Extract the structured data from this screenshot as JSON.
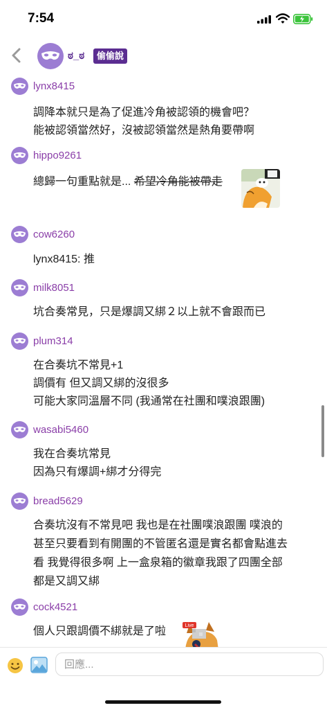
{
  "status_bar": {
    "time": "7:54"
  },
  "header": {
    "author": "ಠ_ಠ",
    "badge": "偷偷說"
  },
  "comments": [
    {
      "user": "lynx8415",
      "lines": [
        "調降本就只是為了促進冷角被認領的機會吧？",
        "能被認領當然好，沒被認領當然是熱角要帶啊"
      ]
    },
    {
      "user": "hippo9261",
      "lines": [
        "總歸一句重點就是... "
      ],
      "strike": "希望冷角能被帶走"
    },
    {
      "user": "cow6260",
      "lines": [
        "lynx8415: 推"
      ]
    },
    {
      "user": "milk8051",
      "lines": [
        "坑合奏常見，只是爆調又綁２以上就不會跟而已"
      ]
    },
    {
      "user": "plum314",
      "lines": [
        "在合奏坑不常見+1",
        "調價有 但又調又綁的沒很多",
        "可能大家同溫層不同 (我通常在社團和噗浪跟團)"
      ]
    },
    {
      "user": "wasabi5460",
      "lines": [
        "我在合奏坑常見",
        "因為只有爆調+綁才分得完"
      ]
    },
    {
      "user": "bread5629",
      "lines": [
        "合奏坑沒有不常見吧 我也是在社團噗浪跟團 噗浪的",
        "甚至只要看到有開團的不管匿名還是實名都會點進去",
        "看 我覺得很多啊 上一盒泉箱的徽章我跟了四團全部",
        "都是又調又綁"
      ]
    },
    {
      "user": "cock4521",
      "lines": [
        "個人只跟調價不綁就是了啦"
      ]
    }
  ],
  "sticker_badge": "Live",
  "input": {
    "placeholder": "回應..."
  },
  "colors": {
    "brand_purple": "#5b2d91",
    "username": "#8a3ea8",
    "avatar": "#9c7dd3",
    "battery": "#3cc43c"
  },
  "icons": [
    "back-chevron-icon",
    "signal-icon",
    "wifi-icon",
    "battery-icon",
    "emoji-icon",
    "image-icon"
  ]
}
